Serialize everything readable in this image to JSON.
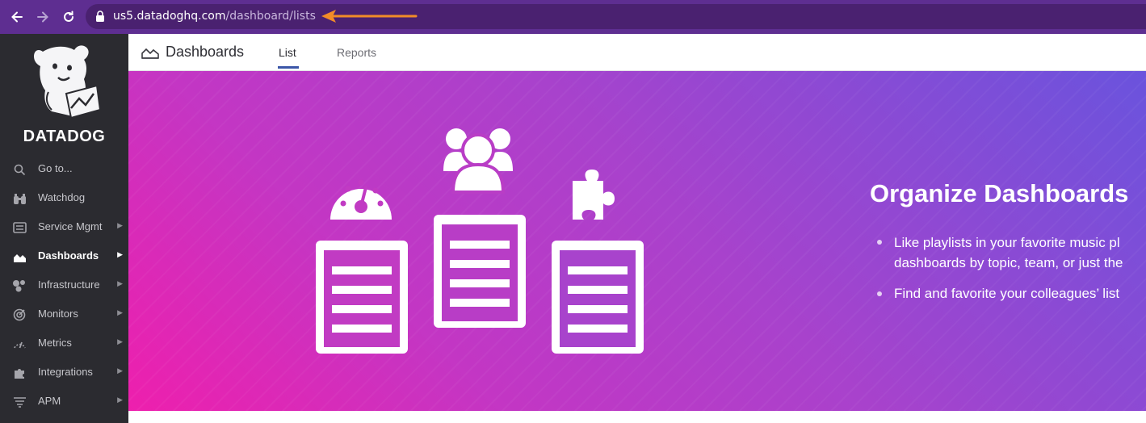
{
  "browser": {
    "url_domain": "us5.datadoghq.com",
    "url_path": "/dashboard/lists",
    "annotation_arrow_color": "#f28c28"
  },
  "sidebar": {
    "brand": "DATADOG",
    "items": [
      {
        "label": "Go to...",
        "icon": "search-icon",
        "has_submenu": false,
        "active": false
      },
      {
        "label": "Watchdog",
        "icon": "binoculars-icon",
        "has_submenu": false,
        "active": false
      },
      {
        "label": "Service Mgmt",
        "icon": "service-icon",
        "has_submenu": true,
        "active": false
      },
      {
        "label": "Dashboards",
        "icon": "chart-area-icon",
        "has_submenu": true,
        "active": true
      },
      {
        "label": "Infrastructure",
        "icon": "infrastructure-icon",
        "has_submenu": true,
        "active": false
      },
      {
        "label": "Monitors",
        "icon": "monitor-icon",
        "has_submenu": true,
        "active": false
      },
      {
        "label": "Metrics",
        "icon": "gauge-icon",
        "has_submenu": true,
        "active": false
      },
      {
        "label": "Integrations",
        "icon": "puzzle-icon",
        "has_submenu": true,
        "active": false
      },
      {
        "label": "APM",
        "icon": "apm-icon",
        "has_submenu": true,
        "active": false
      }
    ]
  },
  "header": {
    "title": "Dashboards",
    "tabs": [
      {
        "label": "List",
        "active": true
      },
      {
        "label": "Reports",
        "active": false
      }
    ]
  },
  "banner": {
    "title": "Organize Dashboards",
    "bullets": [
      "Like playlists in your favorite music pl",
      "dashboards by topic, team, or just the",
      "Find and favorite your colleagues’ list"
    ],
    "gradient_colors": [
      "#ee1fad",
      "#a842cc",
      "#6a53dd"
    ]
  }
}
